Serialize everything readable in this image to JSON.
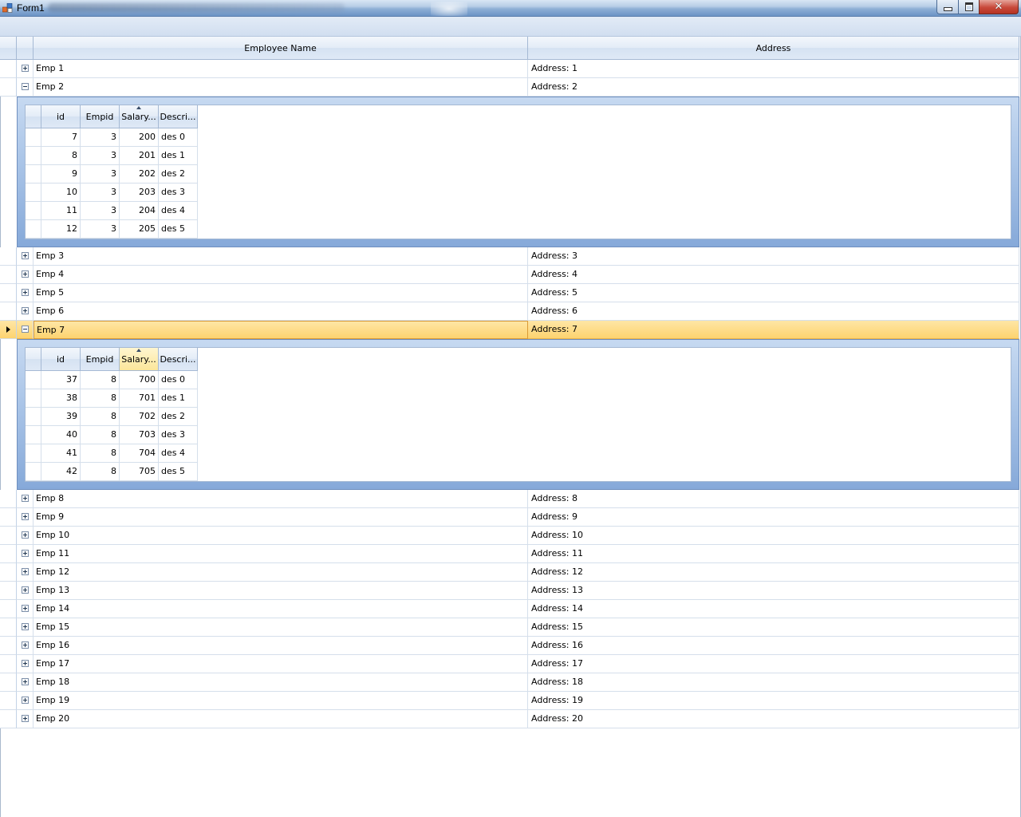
{
  "window": {
    "title": "Form1",
    "close_glyph": "✕"
  },
  "columns": {
    "name": "Employee Name",
    "address": "Address"
  },
  "sub_columns": [
    "id",
    "Empid",
    "Salary...",
    "Descri..."
  ],
  "sorted_sub_column": 2,
  "selected_row": 6,
  "employees": [
    {
      "name": "Emp 1",
      "address": "Address: 1"
    },
    {
      "name": "Emp 2",
      "address": "Address: 2",
      "details": [
        [
          "7",
          "3",
          "200",
          "des 0"
        ],
        [
          "8",
          "3",
          "201",
          "des 1"
        ],
        [
          "9",
          "3",
          "202",
          "des 2"
        ],
        [
          "10",
          "3",
          "203",
          "des 3"
        ],
        [
          "11",
          "3",
          "204",
          "des 4"
        ],
        [
          "12",
          "3",
          "205",
          "des 5"
        ]
      ]
    },
    {
      "name": "Emp 3",
      "address": "Address: 3"
    },
    {
      "name": "Emp 4",
      "address": "Address: 4"
    },
    {
      "name": "Emp 5",
      "address": "Address: 5"
    },
    {
      "name": "Emp 6",
      "address": "Address: 6"
    },
    {
      "name": "Emp 7",
      "address": "Address: 7",
      "details": [
        [
          "37",
          "8",
          "700",
          "des 0"
        ],
        [
          "38",
          "8",
          "701",
          "des 1"
        ],
        [
          "39",
          "8",
          "702",
          "des 2"
        ],
        [
          "40",
          "8",
          "703",
          "des 3"
        ],
        [
          "41",
          "8",
          "704",
          "des 4"
        ],
        [
          "42",
          "8",
          "705",
          "des 5"
        ]
      ]
    },
    {
      "name": "Emp 8",
      "address": "Address: 8"
    },
    {
      "name": "Emp 9",
      "address": "Address: 9"
    },
    {
      "name": "Emp 10",
      "address": "Address: 10"
    },
    {
      "name": "Emp 11",
      "address": "Address: 11"
    },
    {
      "name": "Emp 12",
      "address": "Address: 12"
    },
    {
      "name": "Emp 13",
      "address": "Address: 13"
    },
    {
      "name": "Emp 14",
      "address": "Address: 14"
    },
    {
      "name": "Emp 15",
      "address": "Address: 15"
    },
    {
      "name": "Emp 16",
      "address": "Address: 16"
    },
    {
      "name": "Emp 17",
      "address": "Address: 17"
    },
    {
      "name": "Emp 18",
      "address": "Address: 18"
    },
    {
      "name": "Emp 19",
      "address": "Address: 19"
    },
    {
      "name": "Emp 20",
      "address": "Address: 20"
    }
  ]
}
